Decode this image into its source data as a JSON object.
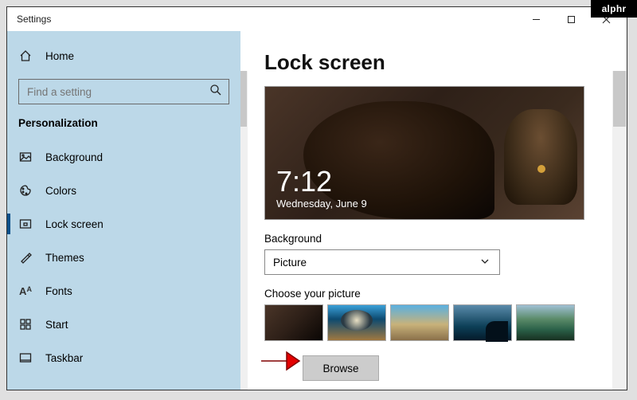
{
  "window": {
    "title": "Settings"
  },
  "logo": "alphr",
  "sidebar": {
    "home": "Home",
    "search_placeholder": "Find a setting",
    "section": "Personalization",
    "items": [
      {
        "label": "Background"
      },
      {
        "label": "Colors"
      },
      {
        "label": "Lock screen"
      },
      {
        "label": "Themes"
      },
      {
        "label": "Fonts"
      },
      {
        "label": "Start"
      },
      {
        "label": "Taskbar"
      }
    ]
  },
  "main": {
    "title": "Lock screen",
    "clock_time": "7:12",
    "clock_date": "Wednesday, June 9",
    "bg_label": "Background",
    "bg_value": "Picture",
    "choose_label": "Choose your picture",
    "browse_label": "Browse"
  }
}
